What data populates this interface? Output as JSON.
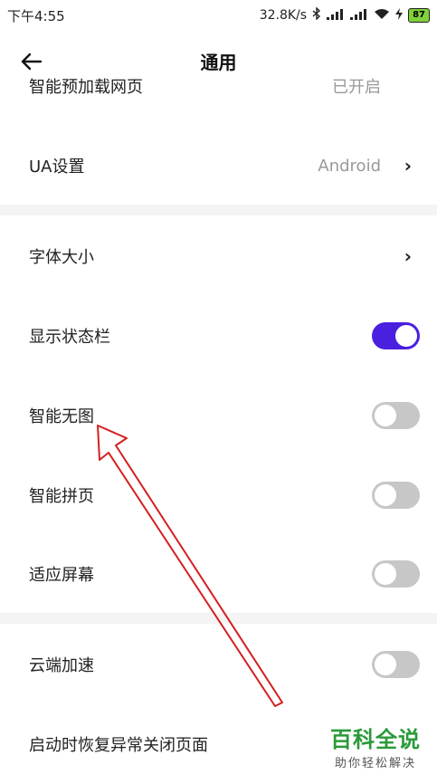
{
  "status_bar": {
    "time": "下午4:55",
    "speed": "32.8K/s",
    "battery": "87"
  },
  "header": {
    "title": "通用"
  },
  "partial_row": {
    "label": "智能预加载网页",
    "value": "已开启"
  },
  "rows": [
    {
      "label": "UA设置",
      "value": "Android",
      "control": "chevron"
    },
    {
      "label": "字体大小",
      "control": "chevron"
    },
    {
      "label": "显示状态栏",
      "control": "toggle",
      "on": true
    },
    {
      "label": "智能无图",
      "control": "toggle",
      "on": false
    },
    {
      "label": "智能拼页",
      "control": "toggle",
      "on": false
    },
    {
      "label": "适应屏幕",
      "control": "toggle",
      "on": false
    },
    {
      "label": "云端加速",
      "control": "toggle",
      "on": false
    },
    {
      "label": "启动时恢复异常关闭页面",
      "control": "none"
    }
  ],
  "chevron_glyph": "›",
  "colors": {
    "accent": "#4a1fe0",
    "toggle_off": "#c7c7c7",
    "annotation": "#d42020"
  },
  "watermark": {
    "title": "百科全说",
    "subtitle": "助你轻松解决"
  }
}
